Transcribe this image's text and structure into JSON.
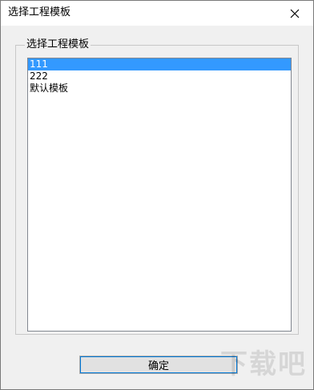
{
  "window": {
    "title": "选择工程模板"
  },
  "icons": {
    "close": "close-icon"
  },
  "group": {
    "label": "选择工程模板"
  },
  "list": {
    "items": [
      {
        "label": "111",
        "selected": true
      },
      {
        "label": "222",
        "selected": false
      },
      {
        "label": "默认模板",
        "selected": false
      }
    ]
  },
  "buttons": {
    "ok_label": "确定"
  },
  "watermark": {
    "text": "下载吧"
  },
  "colors": {
    "selection": "#3399ff",
    "window_bg": "#f0f0f0",
    "titlebar_bg": "#ffffff",
    "focus": "#0078d7"
  }
}
